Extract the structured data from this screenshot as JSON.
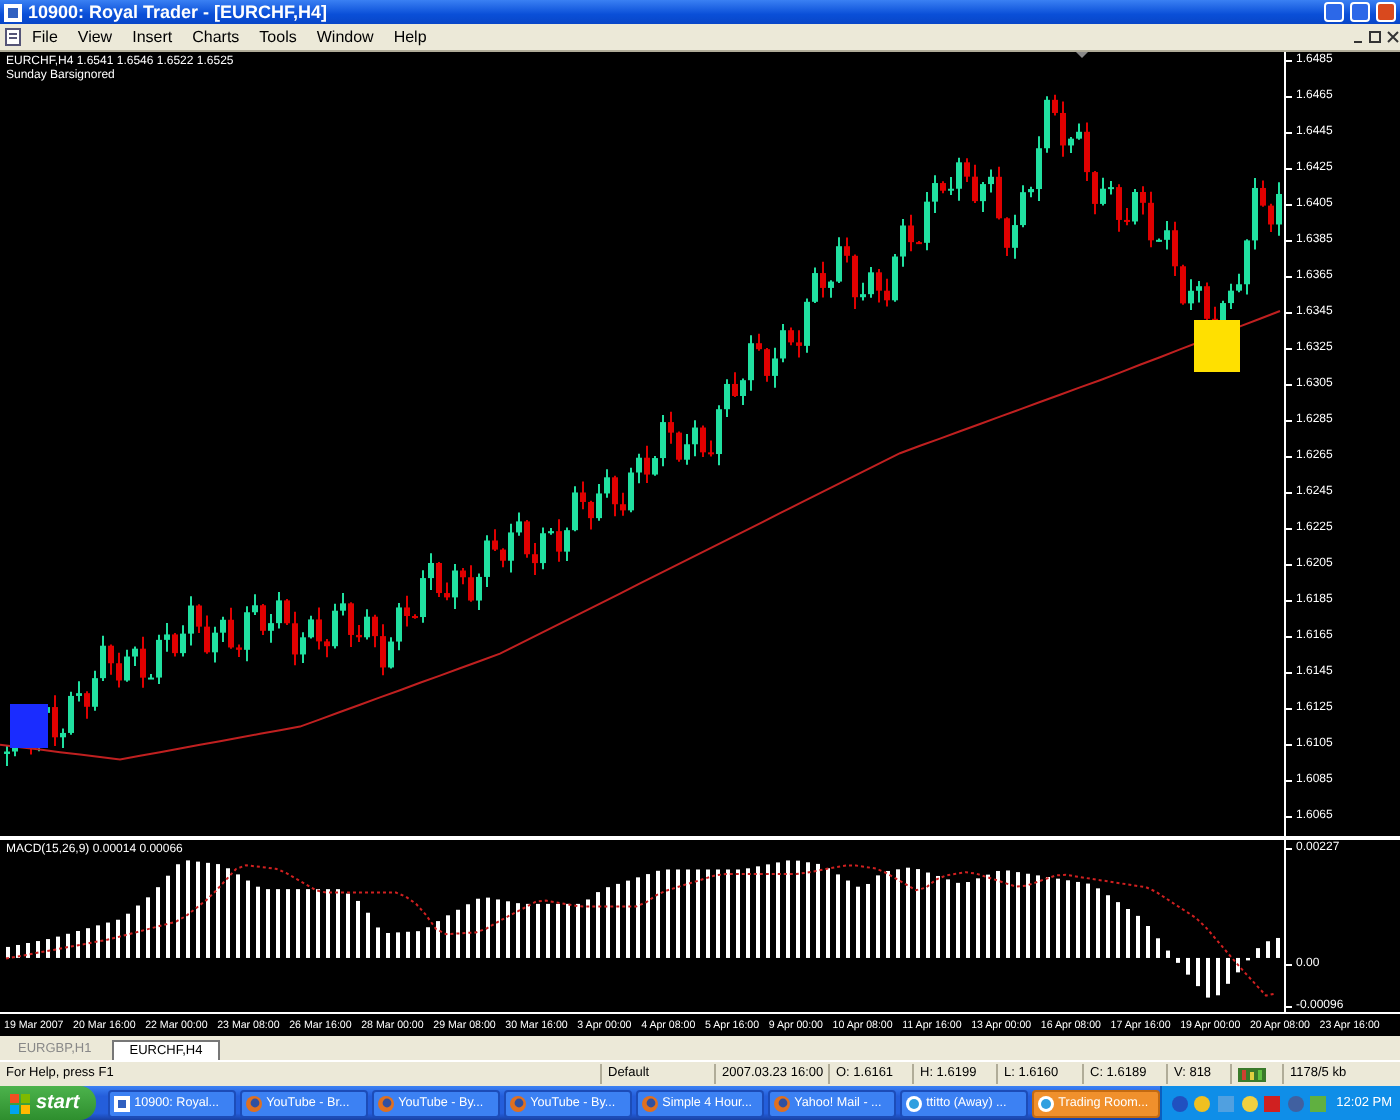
{
  "window": {
    "title": "10900: Royal Trader - [EURCHF,H4]"
  },
  "menu": [
    "File",
    "View",
    "Insert",
    "Charts",
    "Tools",
    "Window",
    "Help"
  ],
  "chart": {
    "header": "EURCHF,H4  1.6541 1.6546 1.6522 1.6525",
    "note": "Sunday Barsignored",
    "price_ticks": [
      "1.6485",
      "1.6465",
      "1.6445",
      "1.6425",
      "1.6405",
      "1.6385",
      "1.6365",
      "1.6345",
      "1.6325",
      "1.6305",
      "1.6285",
      "1.6265",
      "1.6245",
      "1.6225",
      "1.6205",
      "1.6185",
      "1.6165",
      "1.6145",
      "1.6125",
      "1.6105",
      "1.6085",
      "1.6065"
    ],
    "markers": [
      {
        "color": "#1a2cff"
      },
      {
        "color": "#ffe000"
      }
    ]
  },
  "macd": {
    "label": "MACD(15,26,9) 0.00014 0.00066",
    "ticks": [
      "0.00227",
      "0.00",
      "-0.00096"
    ]
  },
  "time_axis": [
    "19 Mar 2007",
    "20 Mar 16:00",
    "22 Mar 00:00",
    "23 Mar 08:00",
    "26 Mar 16:00",
    "28 Mar 00:00",
    "29 Mar 08:00",
    "30 Mar 16:00",
    "3 Apr 00:00",
    "4 Apr 08:00",
    "5 Apr 16:00",
    "9 Apr 00:00",
    "10 Apr 08:00",
    "11 Apr 16:00",
    "13 Apr 00:00",
    "16 Apr 08:00",
    "17 Apr 16:00",
    "19 Apr 00:00",
    "20 Apr 08:00",
    "23 Apr 16:00"
  ],
  "tabs": [
    {
      "label": "EURGBP,H1",
      "selected": false
    },
    {
      "label": "EURCHF,H4",
      "selected": true
    }
  ],
  "status_bar": {
    "help": "For Help, press F1",
    "profile": "Default",
    "time": "2007.03.23 16:00",
    "open": "O: 1.6161",
    "high": "H: 1.6199",
    "low": "L: 1.6160",
    "close": "C: 1.6189",
    "volume": "V: 818",
    "traffic": "1178/5 kb"
  },
  "taskbar": {
    "start": "start",
    "clock": "12:02 PM",
    "tasks": [
      {
        "label": "10900: Royal...",
        "kind": "app",
        "flashing": false
      },
      {
        "label": "YouTube - Br...",
        "kind": "browser",
        "flashing": false
      },
      {
        "label": "YouTube - By...",
        "kind": "browser",
        "flashing": false
      },
      {
        "label": "YouTube - By...",
        "kind": "browser",
        "flashing": false
      },
      {
        "label": "Simple 4 Hour...",
        "kind": "browser",
        "flashing": false
      },
      {
        "label": "Yahoo! Mail - ...",
        "kind": "browser",
        "flashing": false
      },
      {
        "label": "ttitto (Away) ...",
        "kind": "messenger",
        "flashing": false
      },
      {
        "label": "Trading Room...",
        "kind": "messenger",
        "flashing": true
      }
    ]
  }
}
